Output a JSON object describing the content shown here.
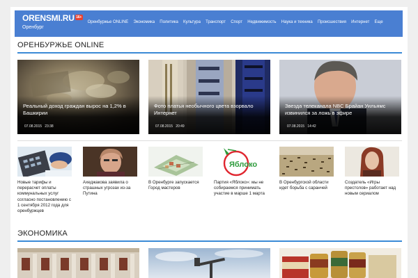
{
  "header": {
    "logo": "ORENSMI.RU",
    "logo_badge": "16+",
    "city": "Оренбург",
    "nav": [
      "Оренбуржье ONLINE",
      "Экономика",
      "Политика",
      "Культура",
      "Транспорт",
      "Спорт",
      "Недвижимость",
      "Наука и техника",
      "Происшествия",
      "Интернет",
      "Еще"
    ]
  },
  "sections": {
    "online_title": "ОРЕНБУРЖЬЕ ONLINE",
    "economy_title": "ЭКОНОМИКА"
  },
  "featured": [
    {
      "title": "Реальный доход граждан вырос на 1,2% в Башкирии",
      "date": "07.08.2015",
      "time": "23:38"
    },
    {
      "title": "Фото платья необычного цвета взорвало Интернет",
      "date": "07.08.2015",
      "time": "20:49"
    },
    {
      "title": "Звезда телеканала NBC Брайан Уильямс извинился за ложь в эфире",
      "date": "07.08.2015",
      "time": "14:42"
    }
  ],
  "small_news": [
    {
      "text": "Новые тарифы и перерасчет оплаты коммунальных услуг согласно постановлению с 1 сентября 2012 года для оренбуржцев"
    },
    {
      "text": "Ахеджакова заявила о страшных угрозах из-за Путина"
    },
    {
      "text": "В Оренбурге запускается Город мастеров"
    },
    {
      "text": "Партия «Яблоко»: мы не собираемся принимать участие в марше 1 марта"
    },
    {
      "text": "В Оренбургской области идет борьба с саранчей"
    },
    {
      "text": "Создатель «Игры престолов» работает над новым сериалом"
    }
  ],
  "yabloko_logo_text": "Яблоко"
}
